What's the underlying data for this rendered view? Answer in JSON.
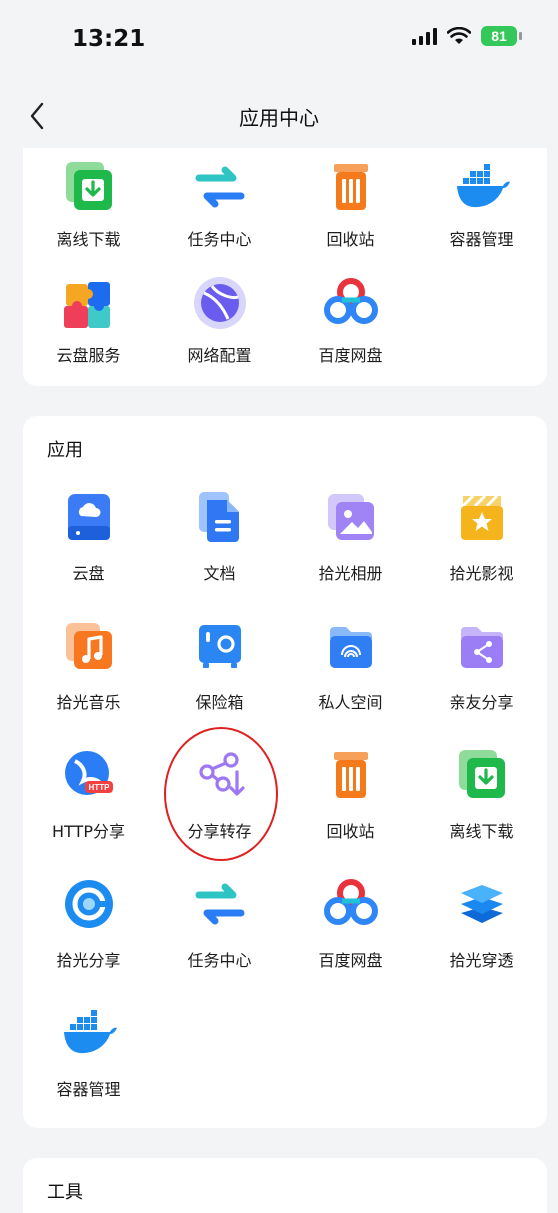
{
  "status": {
    "time": "13:21",
    "battery": "81"
  },
  "nav": {
    "title": "应用中心"
  },
  "top_items": [
    {
      "label": "离线下载",
      "icon": "download-icon"
    },
    {
      "label": "任务中心",
      "icon": "task-center-icon"
    },
    {
      "label": "回收站",
      "icon": "trash-icon"
    },
    {
      "label": "容器管理",
      "icon": "docker-icon"
    },
    {
      "label": "云盘服务",
      "icon": "puzzle-icon"
    },
    {
      "label": "网络配置",
      "icon": "network-icon"
    },
    {
      "label": "百度网盘",
      "icon": "baidu-cloud-icon"
    }
  ],
  "apps": {
    "title": "应用",
    "items": [
      {
        "label": "云盘",
        "icon": "cloud-drive-icon"
      },
      {
        "label": "文档",
        "icon": "document-icon"
      },
      {
        "label": "拾光相册",
        "icon": "photo-album-icon"
      },
      {
        "label": "拾光影视",
        "icon": "video-icon"
      },
      {
        "label": "拾光音乐",
        "icon": "music-icon"
      },
      {
        "label": "保险箱",
        "icon": "safe-icon"
      },
      {
        "label": "私人空间",
        "icon": "private-space-icon"
      },
      {
        "label": "亲友分享",
        "icon": "family-share-icon"
      },
      {
        "label": "HTTP分享",
        "icon": "http-share-icon"
      },
      {
        "label": "分享转存",
        "icon": "share-save-icon"
      },
      {
        "label": "回收站",
        "icon": "trash-icon"
      },
      {
        "label": "离线下载",
        "icon": "download-icon"
      },
      {
        "label": "拾光分享",
        "icon": "shiguang-share-icon"
      },
      {
        "label": "任务中心",
        "icon": "task-center-icon"
      },
      {
        "label": "百度网盘",
        "icon": "baidu-cloud-icon"
      },
      {
        "label": "拾光穿透",
        "icon": "penetration-icon"
      },
      {
        "label": "容器管理",
        "icon": "docker-icon"
      }
    ]
  },
  "tools": {
    "title": "工具"
  }
}
